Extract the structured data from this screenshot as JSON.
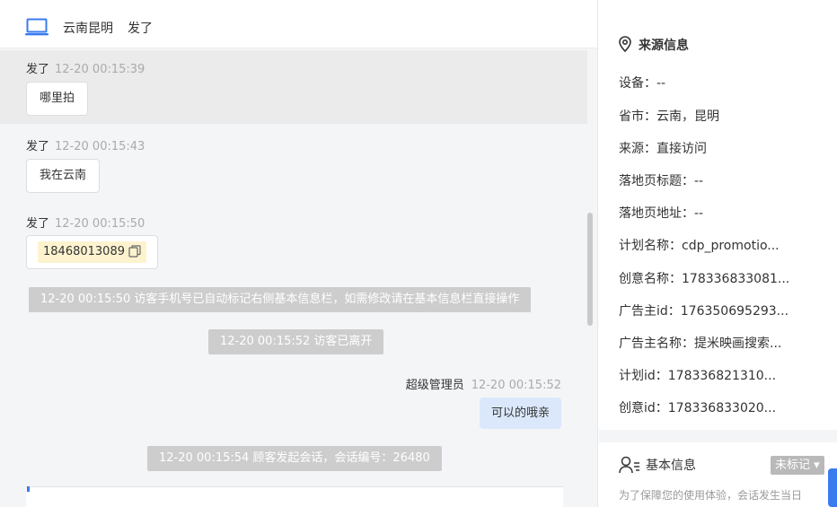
{
  "header": {
    "location": "云南昆明",
    "visitor_name": "发了"
  },
  "messages": [
    {
      "sender": "发了",
      "time": "12-20 00:15:39",
      "text": "哪里拍"
    },
    {
      "sender": "发了",
      "time": "12-20 00:15:43",
      "text": "我在云南"
    },
    {
      "sender": "发了",
      "time": "12-20 00:15:50",
      "text": "18468013089"
    }
  ],
  "system_notices": [
    "12-20 00:15:50 访客手机号已自动标记右侧基本信息栏，如需修改请在基本信息栏直接操作",
    "12-20 00:15:52 访客已离开",
    "12-20 00:15:54 顾客发起会话，会话编号：26480"
  ],
  "agent_message": {
    "sender": "超级管理员",
    "time": "12-20 00:15:52",
    "text": "可以的哦亲"
  },
  "source_info": {
    "title": "来源信息",
    "rows": [
      "设备：--",
      "省市：云南，昆明",
      "来源：直接访问",
      "落地页标题：--",
      "落地页地址：--",
      "计划名称：cdp_promotio...",
      "创意名称：178336833081...",
      "广告主id：176350695293...",
      "广告主名称：提米映画搜索...",
      "计划id：178336821310...",
      "创意id：178336833020..."
    ]
  },
  "basic_info": {
    "title": "基本信息",
    "tag_label": "未标记 ▾",
    "privacy_text": "为了保障您的使用体验，会话发生当日"
  },
  "icons": {
    "header": "laptop-icon",
    "source": "location-pin-icon",
    "basic": "user-list-icon",
    "copy": "copy-icon"
  },
  "colors": {
    "accent": "#3a7bf0",
    "agent_bubble": "#dbe8fb",
    "phone_highlight": "#fdf3cf",
    "system_notice": "#cdcdcd"
  }
}
